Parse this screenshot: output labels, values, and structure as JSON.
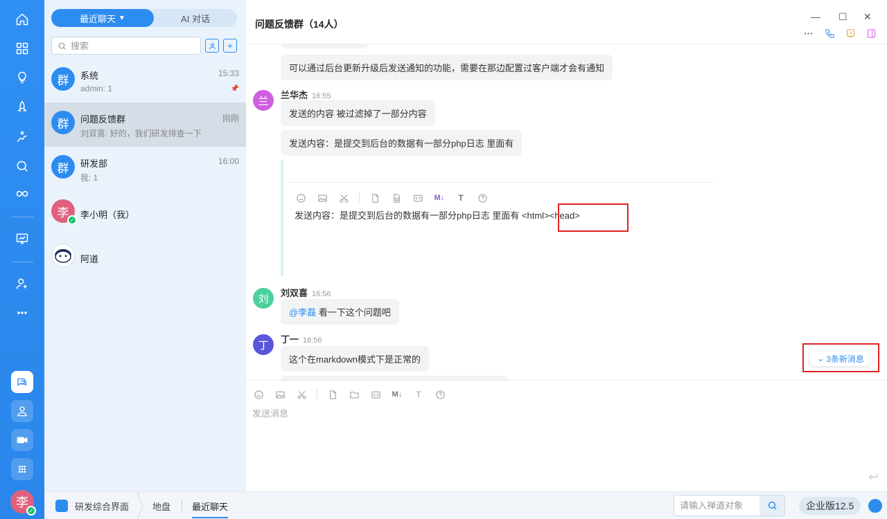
{
  "rail": {
    "avatar_text": "李"
  },
  "list": {
    "tabs": [
      "最近聊天",
      "AI 对话"
    ],
    "search_placeholder": "搜索",
    "conversations": [
      {
        "avatar": "群",
        "name": "系统",
        "preview": "admin: 1",
        "time": "15:33",
        "pinned": true
      },
      {
        "avatar": "群",
        "name": "问题反馈群",
        "preview": "刘双喜: 好的，我们研发排查一下",
        "time": "刚刚",
        "active": true
      },
      {
        "avatar": "群",
        "name": "研发部",
        "preview": "我: 1",
        "time": "16:00"
      },
      {
        "avatar": "李",
        "name": "李小明（我）",
        "preview": "",
        "time": ""
      },
      {
        "avatar": "",
        "name": "阿道",
        "preview": "",
        "time": ""
      }
    ]
  },
  "chat": {
    "title": "问题反馈群（14人）",
    "messages": [
      {
        "text": "可以通过后台更新升级后发送通知的功能，需要在那边配置过客户端才会有通知"
      },
      {
        "avatar": "兰",
        "name": "兰华杰",
        "time": "16:55",
        "bubbles": [
          "发送的内容 被过滤掉了一部分内容",
          "发送内容：是提交到后台的数据有一部分php日志 里面有"
        ]
      },
      {
        "editor_text": "发送内容：是提交到后台的数据有一部分php日志 里面有 <html><head>"
      },
      {
        "avatar": "刘",
        "name": "刘双喜",
        "time": "16:56",
        "mention": "@李磊",
        "text": " 看一下这个问题吧"
      },
      {
        "avatar": "丁",
        "name": "丁一",
        "time": "16:56",
        "text": "这个在markdown模式下是正常的"
      }
    ],
    "new_messages": "3条新消息",
    "composer_placeholder": "发送消息"
  },
  "bottom": {
    "crumbs": [
      "研发综合界面",
      "地盘",
      "最近聊天"
    ],
    "channel_placeholder": "请输入禅道对象",
    "version": "企业版12.5"
  },
  "colors": {
    "primary": "#2d8cf0",
    "highlight": "#e02020",
    "avatar_lan": "#d05fe0",
    "avatar_liu": "#4dd09d",
    "avatar_ding": "#5a56dc"
  }
}
